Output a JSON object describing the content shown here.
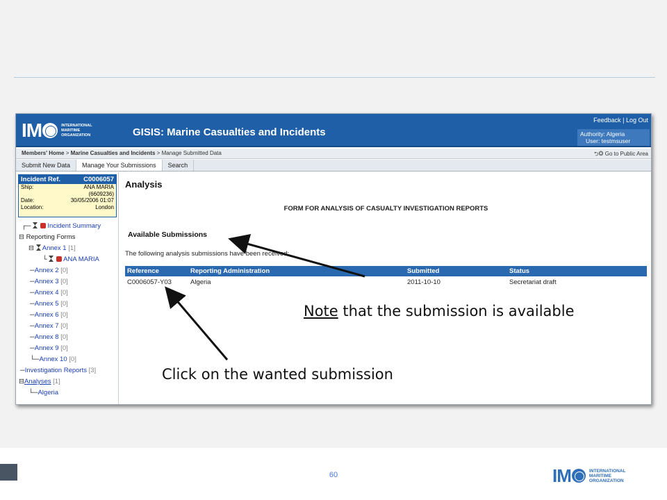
{
  "window": {
    "title": "GISIS: Marine Casualties and Incidents",
    "logo_text": "IMO",
    "org_name": "INTERNATIONAL MARITIME ORGANIZATION",
    "links": {
      "feedback": "Feedback",
      "sep": " | ",
      "logout": "Log Out"
    },
    "authority": "Authority: Algeria",
    "user": "User: testmsuser"
  },
  "breadcrumb": {
    "home": "Members' Home",
    "section": "Marine Casualties and Incidents",
    "current": "Manage Submitted Data",
    "public_link": "Go to Public Area"
  },
  "tabs": [
    {
      "label": "Submit New Data",
      "active": false
    },
    {
      "label": "Manage Your Submissions",
      "active": true
    },
    {
      "label": "Search",
      "active": false
    }
  ],
  "incident": {
    "label": "Incident Ref.",
    "ref": "C0006057",
    "ship_label": "Ship:",
    "ship": "ANA MARIA",
    "ship_no": "(6609236)",
    "date_label": "Date:",
    "date": "30/05/2006 01:07",
    "location_label": "Location:",
    "location": "London"
  },
  "tree": {
    "incident_summary": "Incident Summary",
    "reporting_forms": "Reporting Forms",
    "annex1": "Annex 1",
    "annex1_count": "[1]",
    "ana_maria": "ANA MARIA",
    "annexes": [
      {
        "label": "Annex 2",
        "count": "[0]"
      },
      {
        "label": "Annex 3",
        "count": "[0]"
      },
      {
        "label": "Annex 4",
        "count": "[0]"
      },
      {
        "label": "Annex 5",
        "count": "[0]"
      },
      {
        "label": "Annex 6",
        "count": "[0]"
      },
      {
        "label": "Annex 7",
        "count": "[0]"
      },
      {
        "label": "Annex 8",
        "count": "[0]"
      },
      {
        "label": "Annex 9",
        "count": "[0]"
      },
      {
        "label": "Annex 10",
        "count": "[0]"
      }
    ],
    "investigation_reports": "Investigation Reports",
    "investigation_count": "[3]",
    "analyses": "Analyses",
    "analyses_count": "[1]",
    "algeria": "Algeria"
  },
  "main": {
    "heading": "Analysis",
    "form_title": "FORM FOR ANALYSIS OF CASUALTY INVESTIGATION REPORTS",
    "available_heading": "Available Submissions",
    "intro": "The following analysis submissions have been received:",
    "table": {
      "headers": [
        "Reference",
        "Reporting Administration",
        "Submitted",
        "Status"
      ],
      "rows": [
        [
          "C0006057-Y03",
          "Algeria",
          "2011-10-10",
          "Secretariat draft"
        ]
      ]
    }
  },
  "annotations": {
    "note_word": "Note",
    "note_rest": " that the submission is available",
    "click": "Click on the wanted submission"
  },
  "footer": {
    "page_number": "60",
    "logo_text": "IMO",
    "org_name": "INTERNATIONAL MARITIME ORGANIZATION"
  },
  "colors": {
    "brand_blue": "#1f5fa8",
    "table_header": "#2a68b0",
    "incident_bg": "#fff8c8",
    "link": "#1a3fb3"
  }
}
